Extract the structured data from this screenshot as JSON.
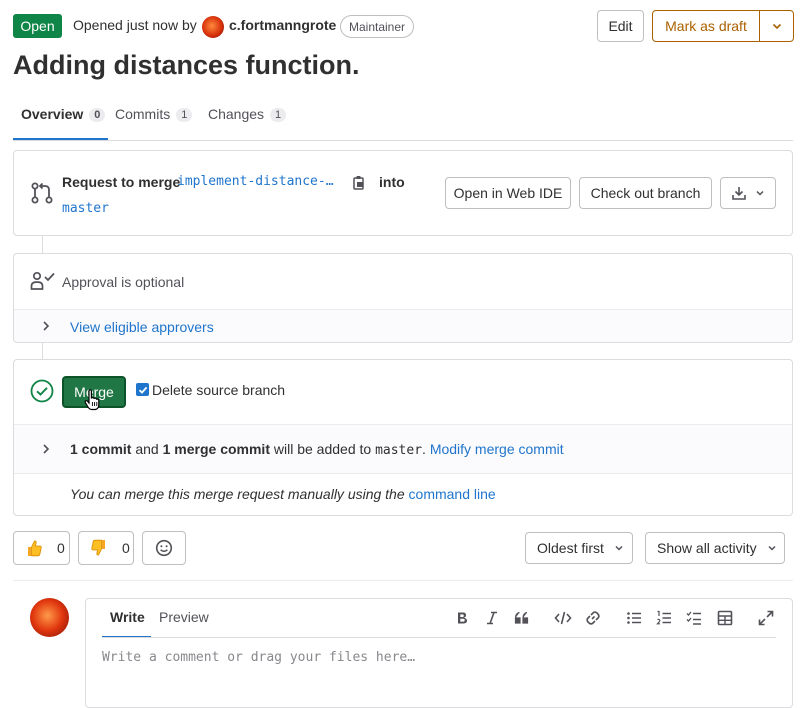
{
  "header": {
    "status": "Open",
    "opened_text": "Opened just now by",
    "author": "c.fortmanngrote",
    "role": "Maintainer",
    "edit_label": "Edit",
    "draft_label": "Mark as draft",
    "title": "Adding distances function."
  },
  "tabs": [
    {
      "label": "Overview",
      "count": "0"
    },
    {
      "label": "Commits",
      "count": "1"
    },
    {
      "label": "Changes",
      "count": "1"
    }
  ],
  "merge_info": {
    "prefix": "Request to merge",
    "source_branch": "implement-distance-…",
    "into": "into",
    "target_branch": "master",
    "web_ide_label": "Open in Web IDE",
    "checkout_label": "Check out branch"
  },
  "approval": {
    "text": "Approval is optional",
    "approvers_link": "View eligible approvers"
  },
  "merge_box": {
    "merge_label": "Merge",
    "delete_source_label": "Delete source branch",
    "delete_source_checked": true,
    "commits_count_text": "1 commit",
    "and": "and",
    "merge_commit_text": "1 merge commit",
    "will_be_added": "will be added to",
    "target": "master",
    "modify_link": "Modify merge commit",
    "manual_text": "You can merge this merge request manually using the",
    "command_line_link": "command line"
  },
  "reactions": {
    "thumbsup_count": "0",
    "thumbsdown_count": "0"
  },
  "sort": {
    "order_label": "Oldest first",
    "activity_label": "Show all activity"
  },
  "comment": {
    "write_tab": "Write",
    "preview_tab": "Preview",
    "placeholder": "Write a comment or drag your files here…"
  },
  "colors": {
    "status_green": "#108548",
    "merge_green": "#217645",
    "draft_orange": "#ab6100",
    "link_blue": "#1f75cb"
  }
}
